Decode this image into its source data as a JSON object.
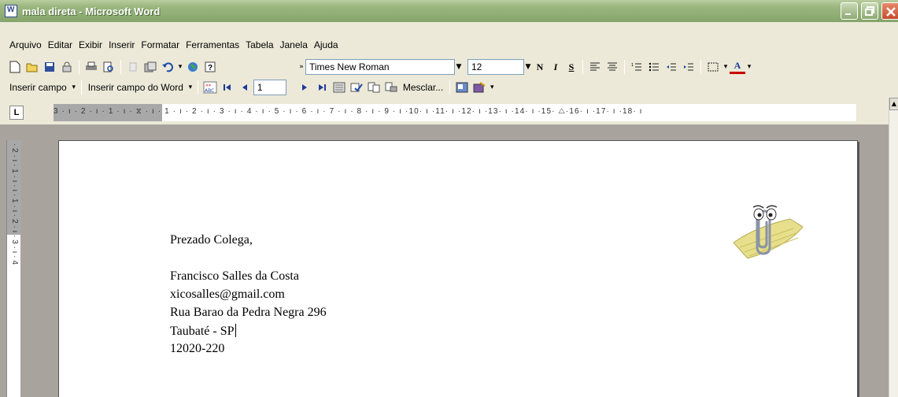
{
  "window": {
    "title": "mala direta - Microsoft Word"
  },
  "menu": {
    "items": [
      "Arquivo",
      "Editar",
      "Exibir",
      "Inserir",
      "Formatar",
      "Ferramentas",
      "Tabela",
      "Janela",
      "Ajuda"
    ]
  },
  "formatting": {
    "font_name": "Times New Roman",
    "font_size": "12",
    "bold": "N",
    "italic": "I",
    "underline": "S",
    "font_color_letter": "A"
  },
  "mailmerge": {
    "insert_field": "Inserir campo",
    "insert_word_field": "Inserir campo do Word",
    "record_number": "1",
    "merge_button": "Mesclar..."
  },
  "ruler": {
    "labels": "3 · ı · 2 · ı · 1 · ı · ⧖ · ı · 1 · ı · 2 · ı · 3 · ı · 4 · ı · 5 · ı · 6 · ı · 7 · ı · 8 · ı · 9 · ı ·10· ı ·11· ı ·12· ı ·13· ı ·14· ı ·15· △·16· ı ·17· ı ·18· ı"
  },
  "vruler": {
    "labels": "· 2 · ı · 1 · ı · ı · 1 · ı · 2 · ı · 3 · ı · 4"
  },
  "document": {
    "greeting": "Prezado Colega,",
    "lines": [
      "Francisco Salles da Costa",
      "xicosalles@gmail.com",
      "Rua Barao da Pedra Negra 296",
      "Taubaté - SP",
      "12020-220"
    ]
  },
  "icons": [
    "word-app-icon",
    "new-icon",
    "open-icon",
    "save-icon",
    "permission-icon",
    "print-icon",
    "print-preview-icon",
    "cut-icon",
    "copy-icon",
    "undo-icon",
    "insert-hyperlink-icon",
    "help-icon",
    "office-assistant-clippy"
  ],
  "colors": {
    "titlebar": "#8fae74",
    "chrome": "#ece9d8",
    "workspace": "#a8a49d"
  }
}
